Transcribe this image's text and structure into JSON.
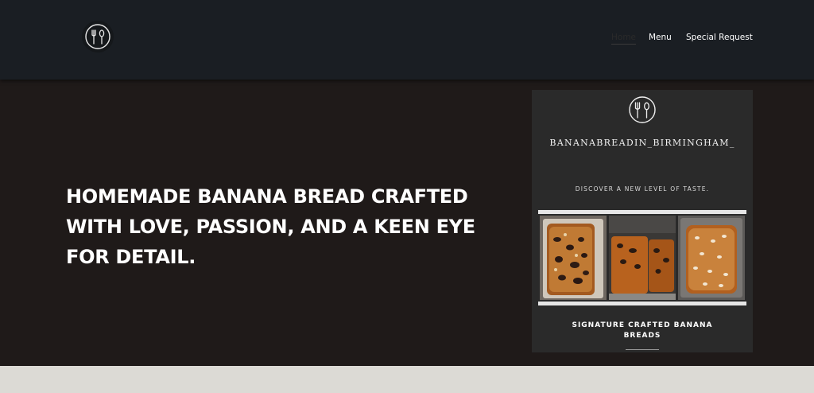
{
  "header": {
    "logo_icon": "fork-spoon-icon",
    "nav": [
      {
        "label": "Home",
        "active": true
      },
      {
        "label": "Menu",
        "active": false
      },
      {
        "label": "Special Request",
        "active": false
      }
    ]
  },
  "hero": {
    "headline": "HOMEMADE BANANA BREAD CRAFTED WITH LOVE, PASSION, AND A KEEN EYE FOR DETAIL."
  },
  "card": {
    "logo_icon": "fork-spoon-icon",
    "handle": "BANANABREADIN_BIRMINGHAM_",
    "tagline": "DISCOVER A NEW LEVEL OF TASTE.",
    "photos": [
      "banana-bread-chocolate-photo",
      "banana-bread-loaves-photo",
      "banana-bread-almond-photo"
    ],
    "caption": "SIGNATURE CRAFTED BANANA BREADS"
  },
  "colors": {
    "header_bg": "#1a1e23",
    "hero_bg": "#1f1a19",
    "card_bg": "#2a2a2a",
    "band_bg": "#dcdad5"
  }
}
